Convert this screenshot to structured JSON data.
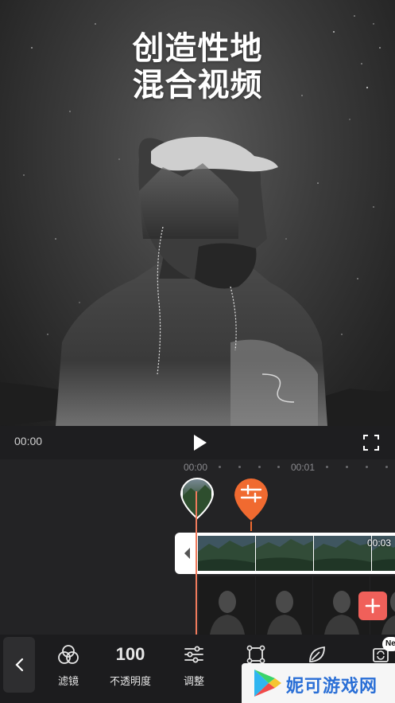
{
  "hero": {
    "title_line1": "创造性地",
    "title_line2": "混合视频"
  },
  "player": {
    "current_time": "00:00",
    "play_icon": "play-icon",
    "fullscreen_icon": "fullscreen-icon"
  },
  "timeline": {
    "ruler_labels": [
      "00:00",
      "00:01"
    ],
    "clip_duration": "00:03",
    "accent_color": "#f06a30",
    "playhead_color": "#ef7a5c",
    "add_button_color": "#f0605a"
  },
  "toolbar": {
    "back_icon": "chevron-left-icon",
    "filter_label": "滤镜",
    "opacity_value": "100",
    "opacity_label": "不透明度",
    "adjust_label": "调整",
    "new_badge": "Ne"
  },
  "watermark": {
    "text": "妮可游戏网"
  }
}
